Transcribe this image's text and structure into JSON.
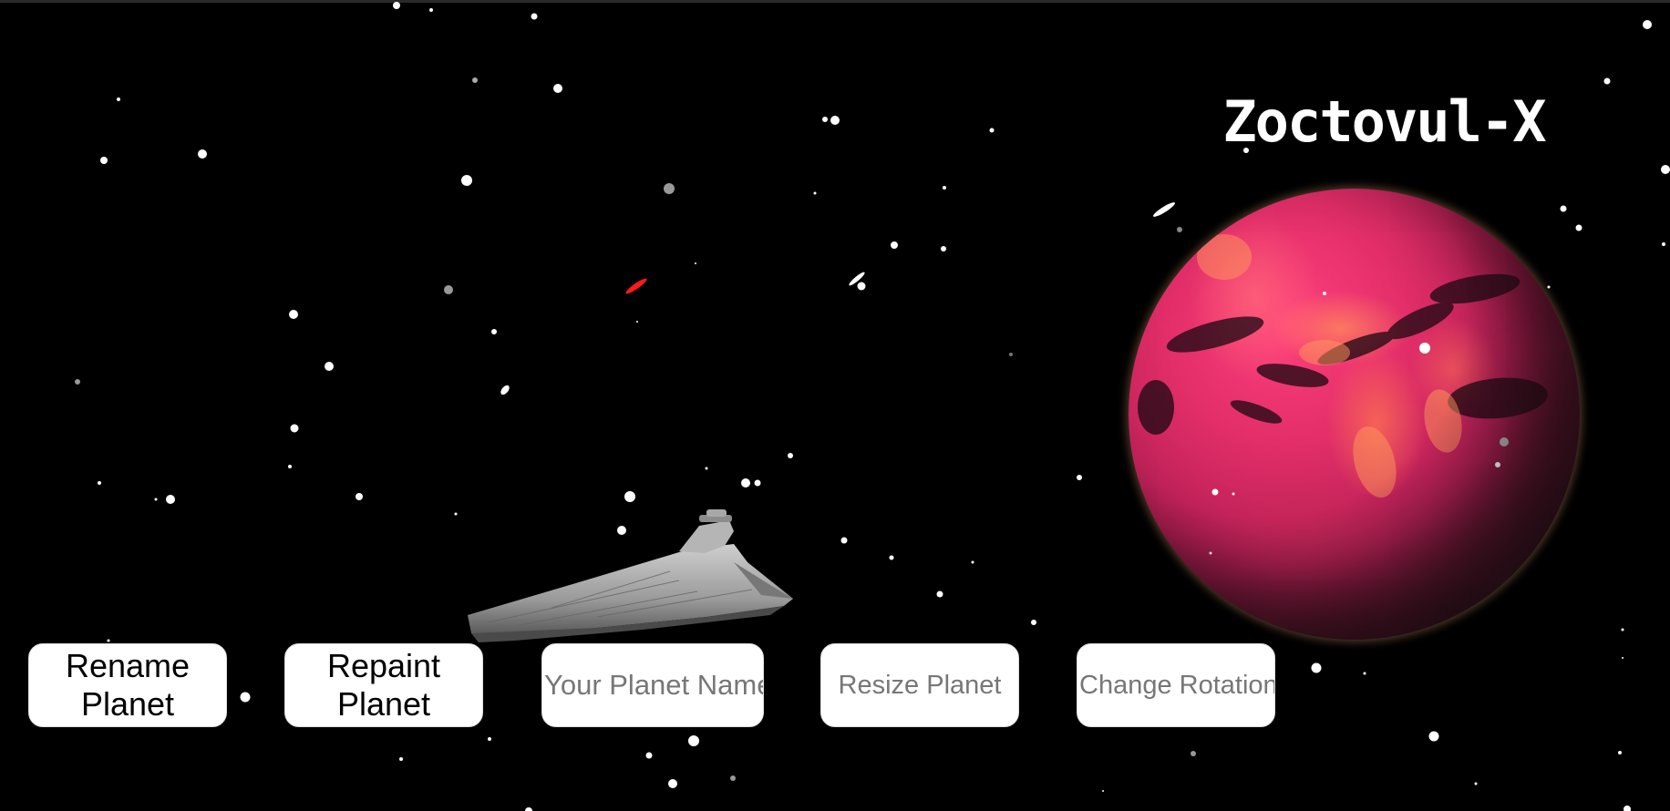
{
  "planet": {
    "name": "Zoctovul-X"
  },
  "controls": {
    "rename_label": "Rename Planet",
    "repaint_label": "Repaint Planet",
    "name_input_placeholder": "Your Planet Name",
    "resize_input_placeholder": "Resize Planet",
    "rotation_input_placeholder": "Change Rotation"
  },
  "colors": {
    "background": "#000000",
    "button_background": "#ffffff",
    "button_text": "#000000",
    "planet_primary": "#e22e69",
    "streak_red": "#ff1a1a"
  }
}
